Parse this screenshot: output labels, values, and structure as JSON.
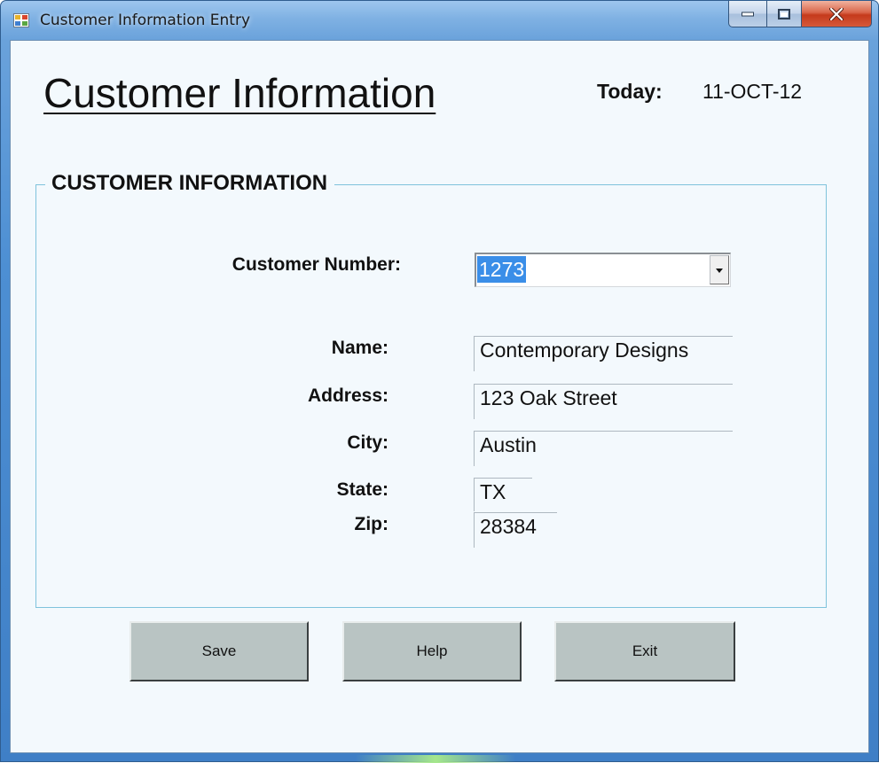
{
  "window": {
    "title": "Customer Information Entry"
  },
  "header": {
    "title": "Customer Information",
    "today_label": "Today:",
    "today_value": "11-OCT-12"
  },
  "group": {
    "title": "CUSTOMER INFORMATION"
  },
  "form": {
    "customer_number_label": "Customer Number:",
    "customer_number_value": "1273",
    "name_label": "Name:",
    "name_value": "Contemporary Designs",
    "address_label": "Address:",
    "address_value": "123 Oak Street",
    "city_label": "City:",
    "city_value": "Austin",
    "state_label": "State:",
    "state_value": "TX",
    "zip_label": "Zip:",
    "zip_value": "28384"
  },
  "buttons": {
    "save": "Save",
    "help": "Help",
    "exit": "Exit"
  },
  "colors": {
    "window_frame": "#4d8fd3",
    "client_background": "#f3f9fd",
    "group_border": "#7fc3dc",
    "button_face": "#b9c4c3",
    "selection": "#3a8ee8",
    "close_button": "#c53a1c"
  },
  "icons": {
    "app": "form-window-icon",
    "minimize": "minimize-icon",
    "maximize": "maximize-icon",
    "close": "close-icon",
    "dropdown": "chevron-down-icon"
  }
}
